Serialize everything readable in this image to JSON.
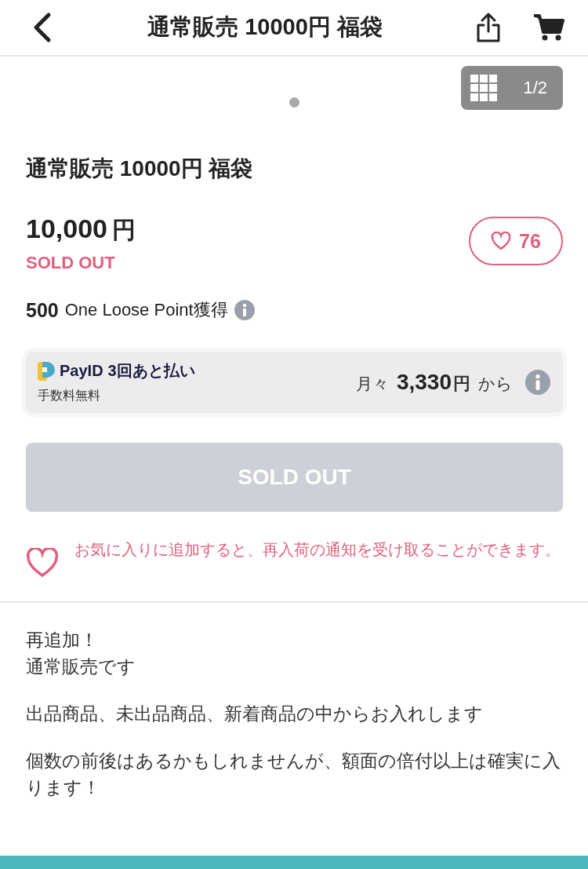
{
  "header": {
    "title": "通常販売 10000円 福袋"
  },
  "gallery": {
    "counter": "1/2",
    "dots": [
      {
        "selected": true
      }
    ]
  },
  "product": {
    "title": "通常販売 10000円 福袋",
    "price": "10,000",
    "currency": "円",
    "status": "SOLD OUT",
    "favorite": {
      "count": "76",
      "selected": false
    },
    "points": {
      "amount": "500",
      "label": "One Loose Point獲得"
    }
  },
  "payid": {
    "brand": "PayID",
    "plan": "3回あと払い",
    "fee": "手数料無料",
    "prefix": "月々",
    "amount": "3,330",
    "currency": "円",
    "suffix": "から"
  },
  "buy_button": {
    "label": "SOLD OUT",
    "disabled": true
  },
  "restock_note": "お気に入りに追加すると、再入荷の通知を受け取ることができます。",
  "description": [
    {
      "lines": [
        "再追加！",
        "通常販売です"
      ]
    },
    {
      "lines": [
        "出品商品、未出品商品、新着商品の中からお入れします"
      ]
    },
    {
      "lines": [
        "個数の前後はあるかもしれませんが、額面の倍付以上は確実に入ります！"
      ]
    }
  ]
}
